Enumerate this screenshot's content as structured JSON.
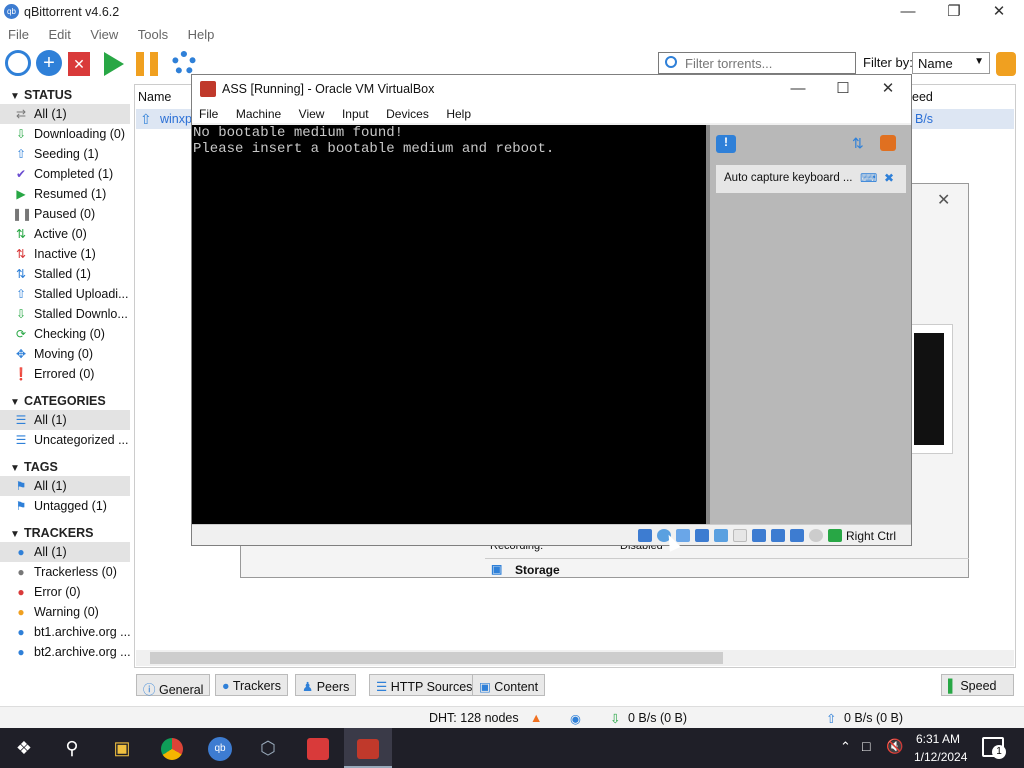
{
  "qb": {
    "title": "qBittorrent v4.6.2",
    "menu": [
      "File",
      "Edit",
      "View",
      "Tools",
      "Help"
    ],
    "filter_placeholder": "Filter torrents...",
    "filter_by_label": "Filter by:",
    "filter_by_value": "Name",
    "columns": {
      "name": "Name",
      "speed": "eed"
    },
    "row": {
      "name": "winxp",
      "speed": "B/s"
    },
    "status_header": "STATUS",
    "status": [
      {
        "icon": "all-icon",
        "label": "All (1)"
      },
      {
        "icon": "downloading-icon",
        "label": "Downloading (0)"
      },
      {
        "icon": "seeding-icon",
        "label": "Seeding (1)"
      },
      {
        "icon": "completed-icon",
        "label": "Completed (1)"
      },
      {
        "icon": "resumed-icon",
        "label": "Resumed (1)"
      },
      {
        "icon": "paused-icon",
        "label": "Paused (0)"
      },
      {
        "icon": "active-icon",
        "label": "Active (0)"
      },
      {
        "icon": "inactive-icon",
        "label": "Inactive (1)"
      },
      {
        "icon": "stalled-icon",
        "label": "Stalled (1)"
      },
      {
        "icon": "stalled-uploading-icon",
        "label": "Stalled Uploadi..."
      },
      {
        "icon": "stalled-downloading-icon",
        "label": "Stalled Downlo..."
      },
      {
        "icon": "checking-icon",
        "label": "Checking (0)"
      },
      {
        "icon": "moving-icon",
        "label": "Moving (0)"
      },
      {
        "icon": "errored-icon",
        "label": "Errored (0)"
      }
    ],
    "categories_header": "CATEGORIES",
    "categories": [
      "All (1)",
      "Uncategorized ..."
    ],
    "tags_header": "TAGS",
    "tags": [
      "All (1)",
      "Untagged (1)"
    ],
    "trackers_header": "TRACKERS",
    "trackers": [
      "All (1)",
      "Trackerless (0)",
      "Error (0)",
      "Warning (0)",
      "bt1.archive.org ...",
      "bt2.archive.org ..."
    ],
    "tabs": [
      "General",
      "Trackers",
      "Peers",
      "HTTP Sources",
      "Content"
    ],
    "speed_button": "Speed",
    "status_bar": {
      "dht": "DHT: 128 nodes",
      "down": "0 B/s (0 B)",
      "up": "0 B/s (0 B)"
    }
  },
  "bg_dialog": {
    "recording_label": "Recording:",
    "recording_value": "Disabled",
    "storage": "Storage"
  },
  "vbox": {
    "title": "ASS [Running] - Oracle VM VirtualBox",
    "menu": [
      "File",
      "Machine",
      "View",
      "Input",
      "Devices",
      "Help"
    ],
    "screen_line1": "No bootable medium found!",
    "screen_line2": "Please insert a bootable medium and reboot.",
    "notice": "Auto capture keyboard ...",
    "host_key": "Right Ctrl"
  },
  "taskbar": {
    "time": "6:31 AM",
    "date": "1/12/2024",
    "notifications": "1"
  }
}
